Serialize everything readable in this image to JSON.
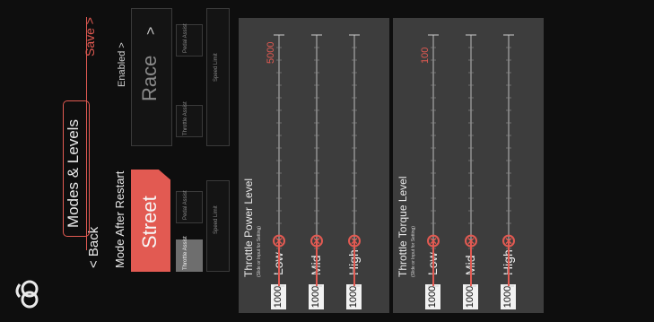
{
  "header": {
    "back_label": "< Back",
    "title": "Modes & Levels",
    "save_label": "Save >",
    "logo_icon": "ofc-logo-icon"
  },
  "mode_after_restart": {
    "label": "Mode After Restart",
    "value": "Enabled >"
  },
  "modes": [
    {
      "label": "Street",
      "selected": true,
      "assists": [
        {
          "label": "Throttle Assist",
          "selected": true
        },
        {
          "label": "Pedal Assist",
          "selected": false
        }
      ],
      "speed_limit_label": "Speed Limit"
    },
    {
      "label": "Race",
      "selected": false,
      "chevron": ">",
      "assists": [
        {
          "label": "Throttle Assist",
          "selected": false
        },
        {
          "label": "Pedal Assist",
          "selected": false
        }
      ],
      "speed_limit_label": "Speed Limit"
    }
  ],
  "panels": [
    {
      "title": "Throttle Power Level",
      "subtitle": "(Slide or Input for Setting)",
      "max_value": "5000",
      "max": 5000,
      "levels": [
        {
          "label": "Low",
          "value": "1000",
          "amount": 1000
        },
        {
          "label": "Mid",
          "value": "1000",
          "amount": 1000
        },
        {
          "label": "High",
          "value": "1000",
          "amount": 1000
        }
      ]
    },
    {
      "title": "Throttle Torque Level",
      "subtitle": "(Slide or Input for Setting)",
      "max_value": "100",
      "max": 100,
      "levels": [
        {
          "label": "Low",
          "value": "1000",
          "amount": 1000
        },
        {
          "label": "Mid",
          "value": "1000",
          "amount": 1000
        },
        {
          "label": "High",
          "value": "1000",
          "amount": 1000
        }
      ]
    }
  ],
  "colors": {
    "accent": "#e25a52",
    "panel": "#3d3d3d",
    "background": "#0e0e0e"
  }
}
